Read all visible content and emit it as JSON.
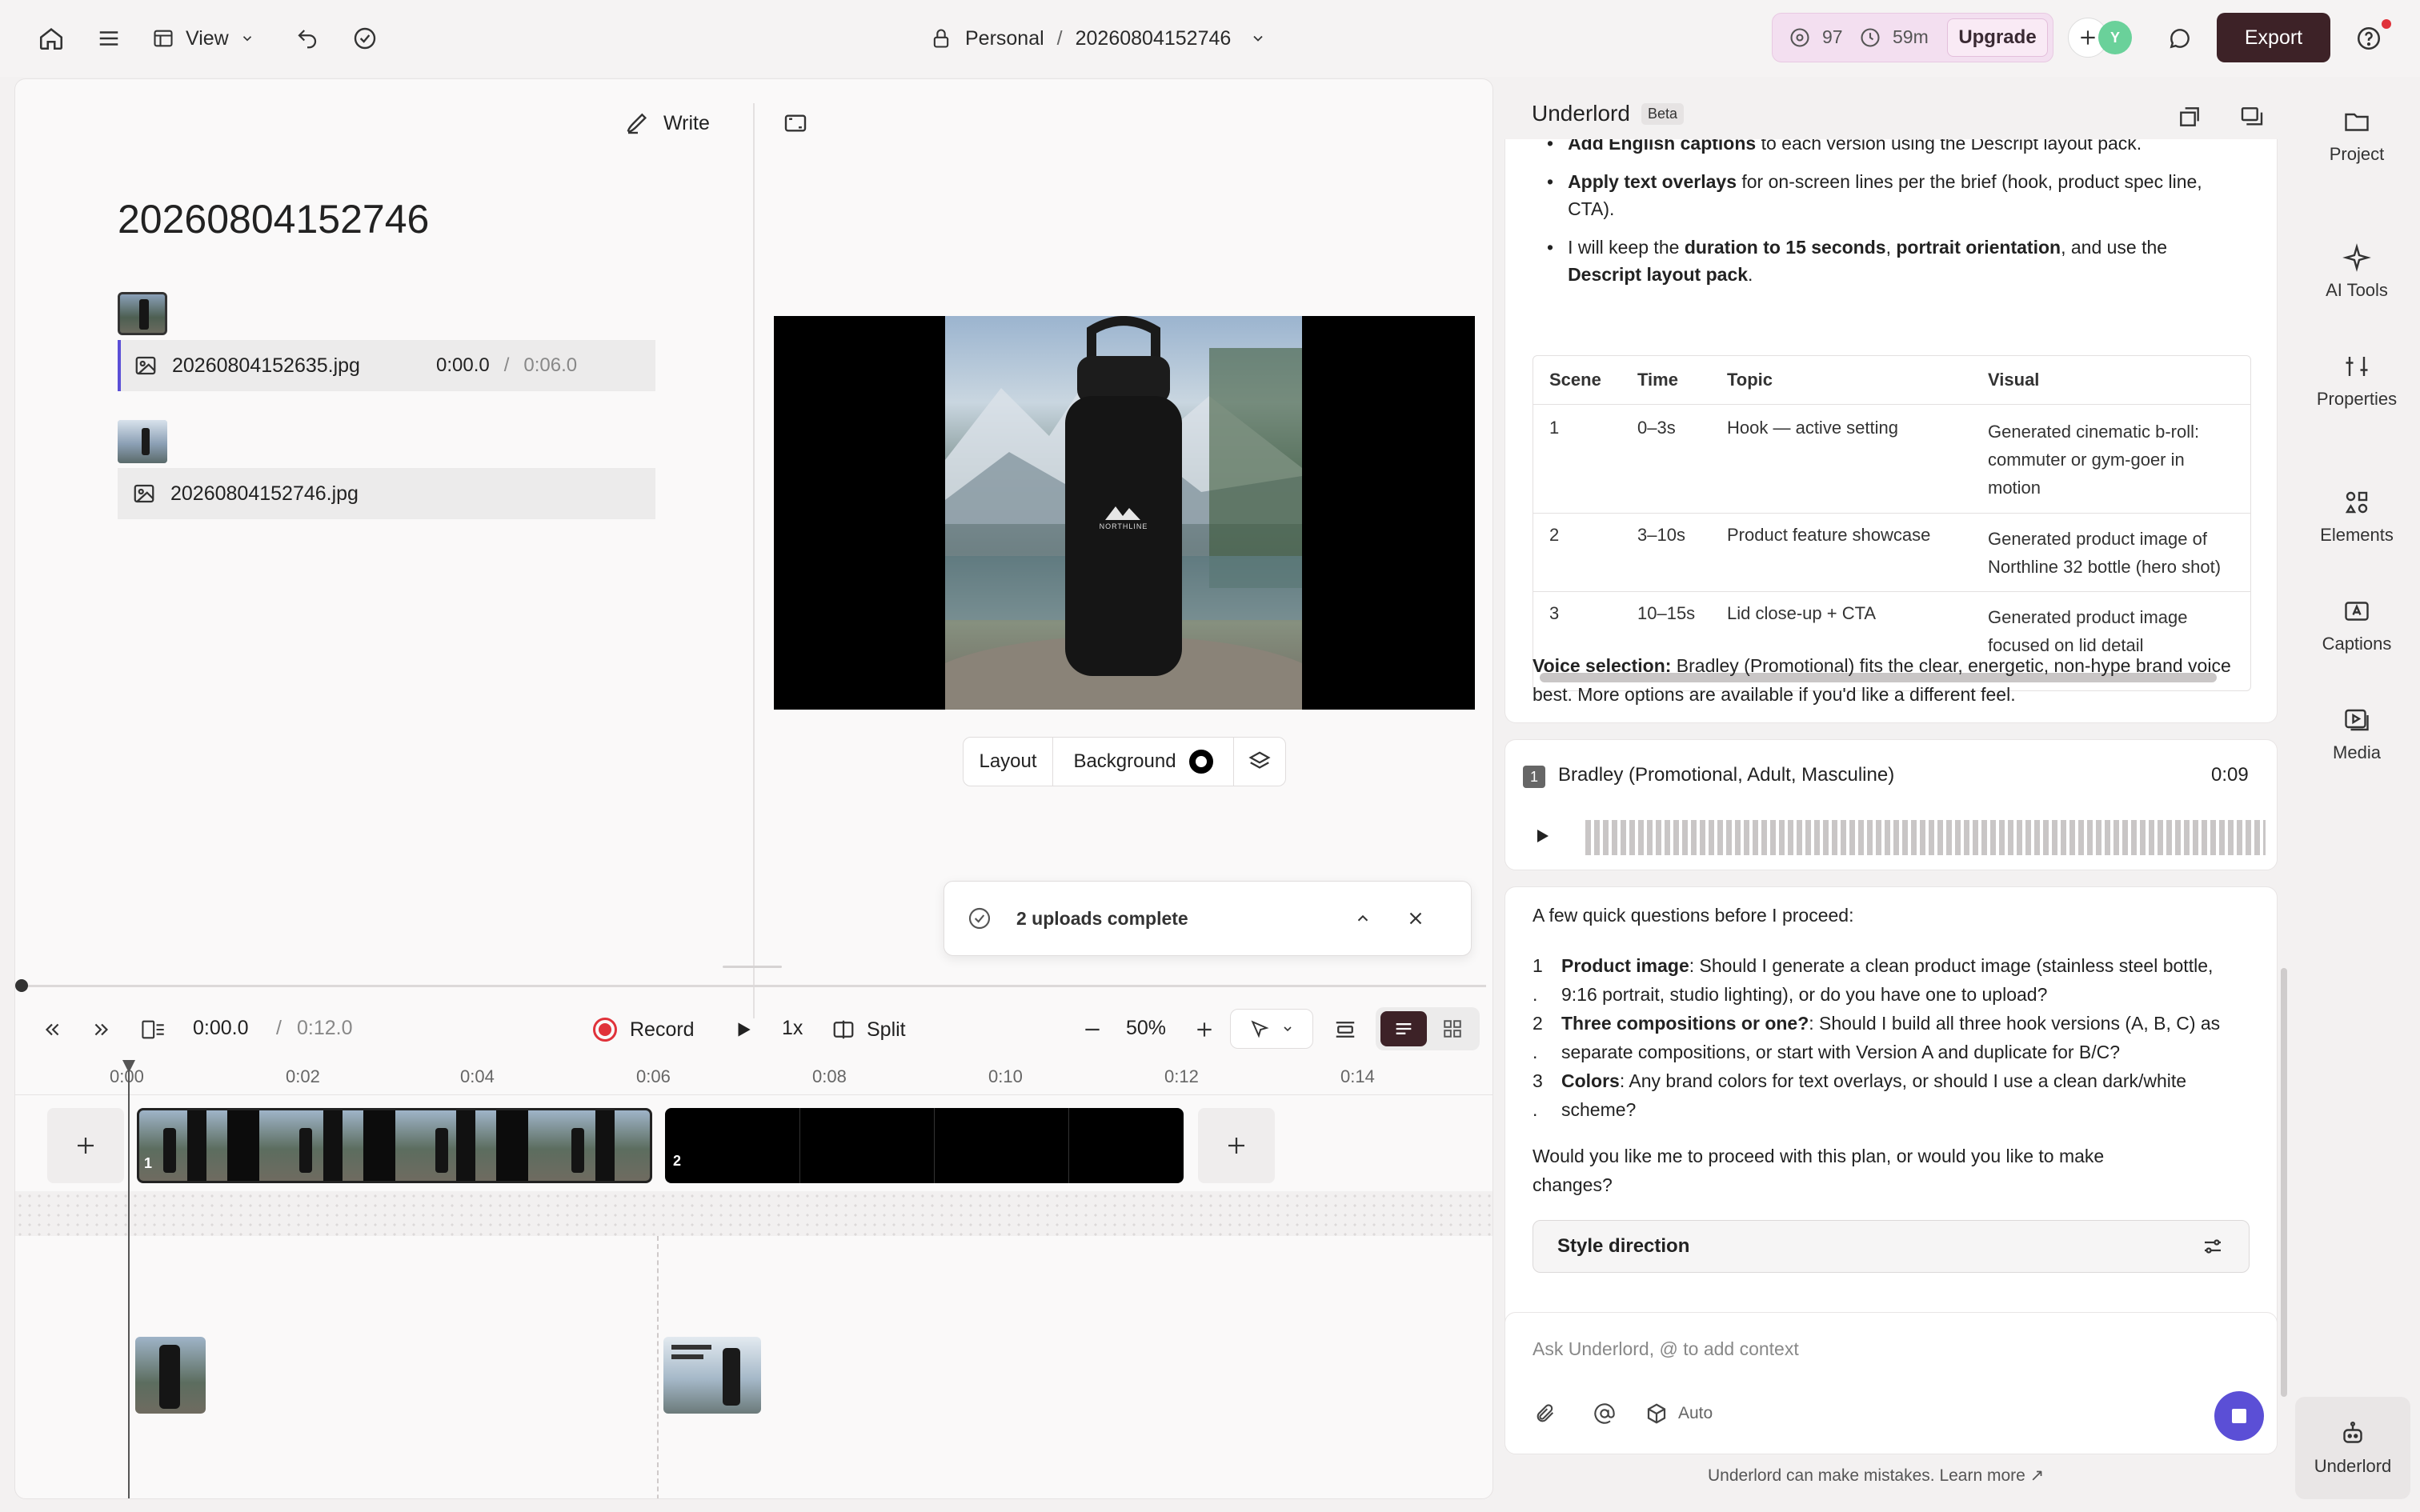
{
  "topbar": {
    "view_label": "View",
    "workspace": "Personal",
    "separator": "/",
    "project_name": "20260804152746",
    "credits_count": "97",
    "time_left": "59m",
    "upgrade_label": "Upgrade",
    "avatar_initial": "Y",
    "export_label": "Export"
  },
  "script": {
    "write_label": "Write",
    "title": "20260804152746",
    "clips": [
      {
        "filename": "20260804152635.jpg",
        "time": "0:00.0",
        "sep": "/",
        "duration": "0:06.0"
      },
      {
        "filename": "20260804152746.jpg"
      }
    ]
  },
  "preview": {
    "brand": "NORTHLINE",
    "layout_label": "Layout",
    "background_label": "Background"
  },
  "toast": {
    "text": "2 uploads complete"
  },
  "transport": {
    "current": "0:00.0",
    "sep": "/",
    "total": "0:12.0",
    "record_label": "Record",
    "speed": "1x",
    "split_label": "Split",
    "zoom": "50%"
  },
  "ruler": [
    "0:00",
    "0:02",
    "0:04",
    "0:06",
    "0:08",
    "0:10",
    "0:12",
    "0:14"
  ],
  "timeline": {
    "scene1": "1",
    "scene2": "2"
  },
  "chat": {
    "title": "Underlord",
    "beta": "Beta",
    "bullets": [
      {
        "b": "Add English captions",
        "t": " to each version using the Descript layout pack."
      },
      {
        "b": "Apply text overlays",
        "t": " for on-screen lines per the brief (hook, product spec line, CTA)."
      },
      {
        "pre": "I will keep the ",
        "b": "duration to 15 seconds",
        "mid": ", ",
        "b2": "portrait orientation",
        "mid2": ", and use the ",
        "b3": "Descript layout pack",
        "post": "."
      }
    ],
    "table_headers": [
      "Scene",
      "Time",
      "Topic",
      "Visual"
    ],
    "table_rows": [
      [
        "1",
        "0–3s",
        "Hook — active setting",
        "Generated cinematic b-roll: commuter or gym-goer in motion"
      ],
      [
        "2",
        "3–10s",
        "Product feature showcase",
        "Generated product image of Northline 32 bottle (hero shot)"
      ],
      [
        "3",
        "10–15s",
        "Lid close-up + CTA",
        "Generated product image focused on lid detail"
      ]
    ],
    "voice_label": "Voice selection:",
    "voice_text": " Bradley (Promotional) fits the clear, energetic, non-hype brand voice best. More options are available if you'd like a different feel.",
    "voice_card": {
      "index": "1",
      "name": "Bradley (Promotional, Adult, Masculine)",
      "duration": "0:09"
    },
    "questions_intro": "A few quick questions before I proceed:",
    "questions": [
      {
        "num": "1 .",
        "b": "Product image",
        "t": ": Should I generate a clean product image (stainless steel bottle, 9:16 portrait, studio lighting), or do you have one to upload?"
      },
      {
        "num": "2 .",
        "b": "Three compositions or one?",
        "t": ": Should I build all three hook versions (A, B, C) as separate compositions, or start with Version A and duplicate for B/C?"
      },
      {
        "num": "3 .",
        "b": "Colors",
        "t": ": Any brand colors for text overlays, or should I use a clean dark/white scheme?"
      }
    ],
    "closing": "Would you like me to proceed with this plan, or would you like to make changes?",
    "style_direction": "Style direction",
    "input_placeholder": "Ask Underlord, @ to add context",
    "auto_label": "Auto",
    "footer": "Underlord can make mistakes. Learn more ↗"
  },
  "rightnav": [
    {
      "label": "Project",
      "icon": "folder-icon"
    },
    {
      "label": "AI Tools",
      "icon": "sparkle-icon"
    },
    {
      "label": "Properties",
      "icon": "sliders-icon"
    },
    {
      "label": "Elements",
      "icon": "elements-icon"
    },
    {
      "label": "Captions",
      "icon": "captions-icon"
    },
    {
      "label": "Media",
      "icon": "media-icon"
    },
    {
      "label": "Underlord",
      "icon": "robot-icon"
    }
  ],
  "colors": {
    "accent": "#5b4fd6",
    "export_bg": "#3d2227",
    "upgrade_bg": "#f1d9ec",
    "record_red": "#e0323a",
    "avatar_green": "#6ad19a"
  }
}
